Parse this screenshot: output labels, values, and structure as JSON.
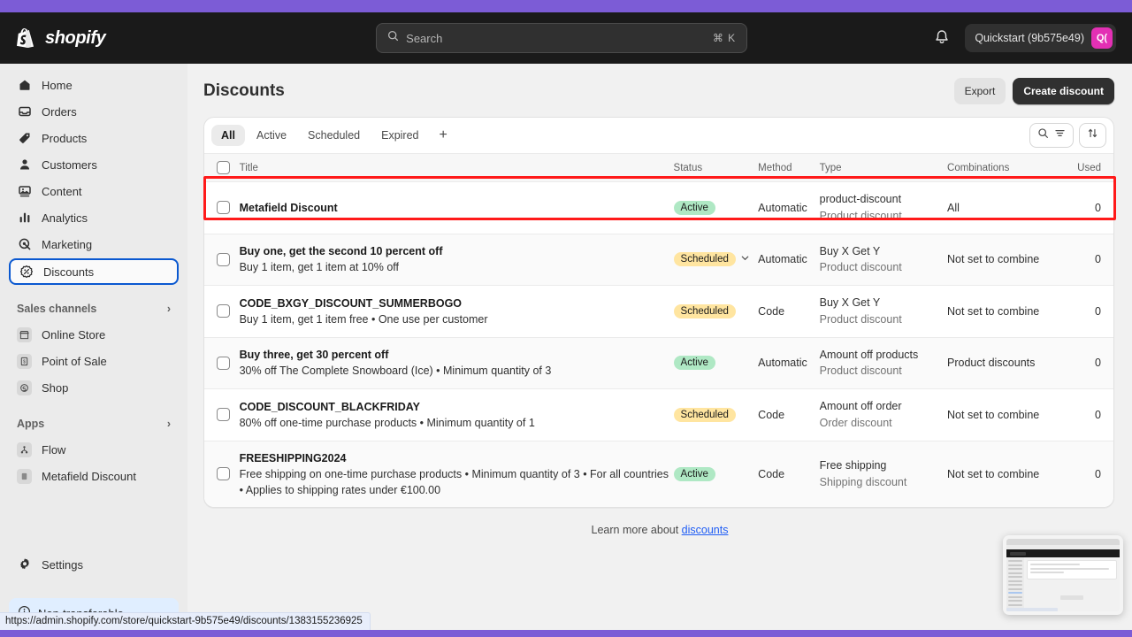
{
  "topbar": {
    "brand": "shopify",
    "search_placeholder": "Search",
    "search_shortcut": "⌘ K",
    "account_name": "Quickstart (9b575e49)",
    "avatar_initials": "Q(",
    "avatar_color": "#e330b4"
  },
  "sidebar": {
    "items": [
      {
        "label": "Home",
        "icon": "home-icon"
      },
      {
        "label": "Orders",
        "icon": "orders-icon"
      },
      {
        "label": "Products",
        "icon": "tag-icon"
      },
      {
        "label": "Customers",
        "icon": "person-icon"
      },
      {
        "label": "Content",
        "icon": "content-icon"
      },
      {
        "label": "Analytics",
        "icon": "bar-chart-icon"
      },
      {
        "label": "Marketing",
        "icon": "marketing-icon"
      },
      {
        "label": "Discounts",
        "icon": "discount-icon",
        "selected": true
      }
    ],
    "sales_channels_label": "Sales channels",
    "sales_channels": [
      {
        "label": "Online Store",
        "icon": "store-icon"
      },
      {
        "label": "Point of Sale",
        "icon": "pos-icon"
      },
      {
        "label": "Shop",
        "icon": "shop-icon"
      }
    ],
    "apps_label": "Apps",
    "apps": [
      {
        "label": "Flow",
        "icon": "flow-icon"
      },
      {
        "label": "Metafield Discount",
        "icon": "app-icon"
      }
    ],
    "settings_label": "Settings",
    "nontransferable_label": "Non-transferable"
  },
  "page": {
    "title": "Discounts",
    "export_label": "Export",
    "create_label": "Create discount",
    "learn_prefix": "Learn more about ",
    "learn_link": "discounts"
  },
  "tabs": [
    {
      "label": "All",
      "active": true
    },
    {
      "label": "Active",
      "active": false
    },
    {
      "label": "Scheduled",
      "active": false
    },
    {
      "label": "Expired",
      "active": false
    }
  ],
  "tab_add_label": "+",
  "table": {
    "columns": [
      "Title",
      "Status",
      "Method",
      "Type",
      "Combinations",
      "Used"
    ],
    "rows": [
      {
        "title": "Metafield Discount",
        "subtitle": "",
        "status": "Active",
        "status_kind": "active",
        "has_chevron": false,
        "method": "Automatic",
        "type_main": "product-discount",
        "type_sub": "Product discount",
        "combinations": "All",
        "used": "0",
        "highlighted": true
      },
      {
        "title": "Buy one, get the second 10 percent off",
        "subtitle": "Buy 1 item, get 1 item at 10% off",
        "status": "Scheduled",
        "status_kind": "scheduled",
        "has_chevron": true,
        "method": "Automatic",
        "type_main": "Buy X Get Y",
        "type_sub": "Product discount",
        "combinations": "Not set to combine",
        "used": "0",
        "highlighted": false
      },
      {
        "title": "CODE_BXGY_DISCOUNT_SUMMERBOGO",
        "subtitle": "Buy 1 item, get 1 item free • One use per customer",
        "status": "Scheduled",
        "status_kind": "scheduled",
        "has_chevron": false,
        "method": "Code",
        "type_main": "Buy X Get Y",
        "type_sub": "Product discount",
        "combinations": "Not set to combine",
        "used": "0",
        "highlighted": false
      },
      {
        "title": "Buy three, get 30 percent off",
        "subtitle": "30% off The Complete Snowboard (Ice) • Minimum quantity of 3",
        "status": "Active",
        "status_kind": "active",
        "has_chevron": false,
        "method": "Automatic",
        "type_main": "Amount off products",
        "type_sub": "Product discount",
        "combinations": "Product discounts",
        "used": "0",
        "highlighted": false
      },
      {
        "title": "CODE_DISCOUNT_BLACKFRIDAY",
        "subtitle": "80% off one-time purchase products • Minimum quantity of 1",
        "status": "Scheduled",
        "status_kind": "scheduled",
        "has_chevron": false,
        "method": "Code",
        "type_main": "Amount off order",
        "type_sub": "Order discount",
        "combinations": "Not set to combine",
        "used": "0",
        "highlighted": false
      },
      {
        "title": "FREESHIPPING2024",
        "subtitle": "Free shipping on one-time purchase products • Minimum quantity of 3 • For all countries • Applies to shipping rates under €100.00",
        "status": "Active",
        "status_kind": "active",
        "has_chevron": false,
        "method": "Code",
        "type_main": "Free shipping",
        "type_sub": "Shipping discount",
        "combinations": "Not set to combine",
        "used": "0",
        "highlighted": false
      }
    ]
  },
  "status_bar": {
    "url": "https://admin.shopify.com/store/quickstart-9b575e49/discounts/1383155236925"
  },
  "colors": {
    "accent_purple": "#7c5cd6",
    "badge_active": "#afe8c4",
    "badge_scheduled": "#ffe5a0",
    "highlight_red": "#ff1a1a",
    "focus_blue": "#0a58d0"
  }
}
